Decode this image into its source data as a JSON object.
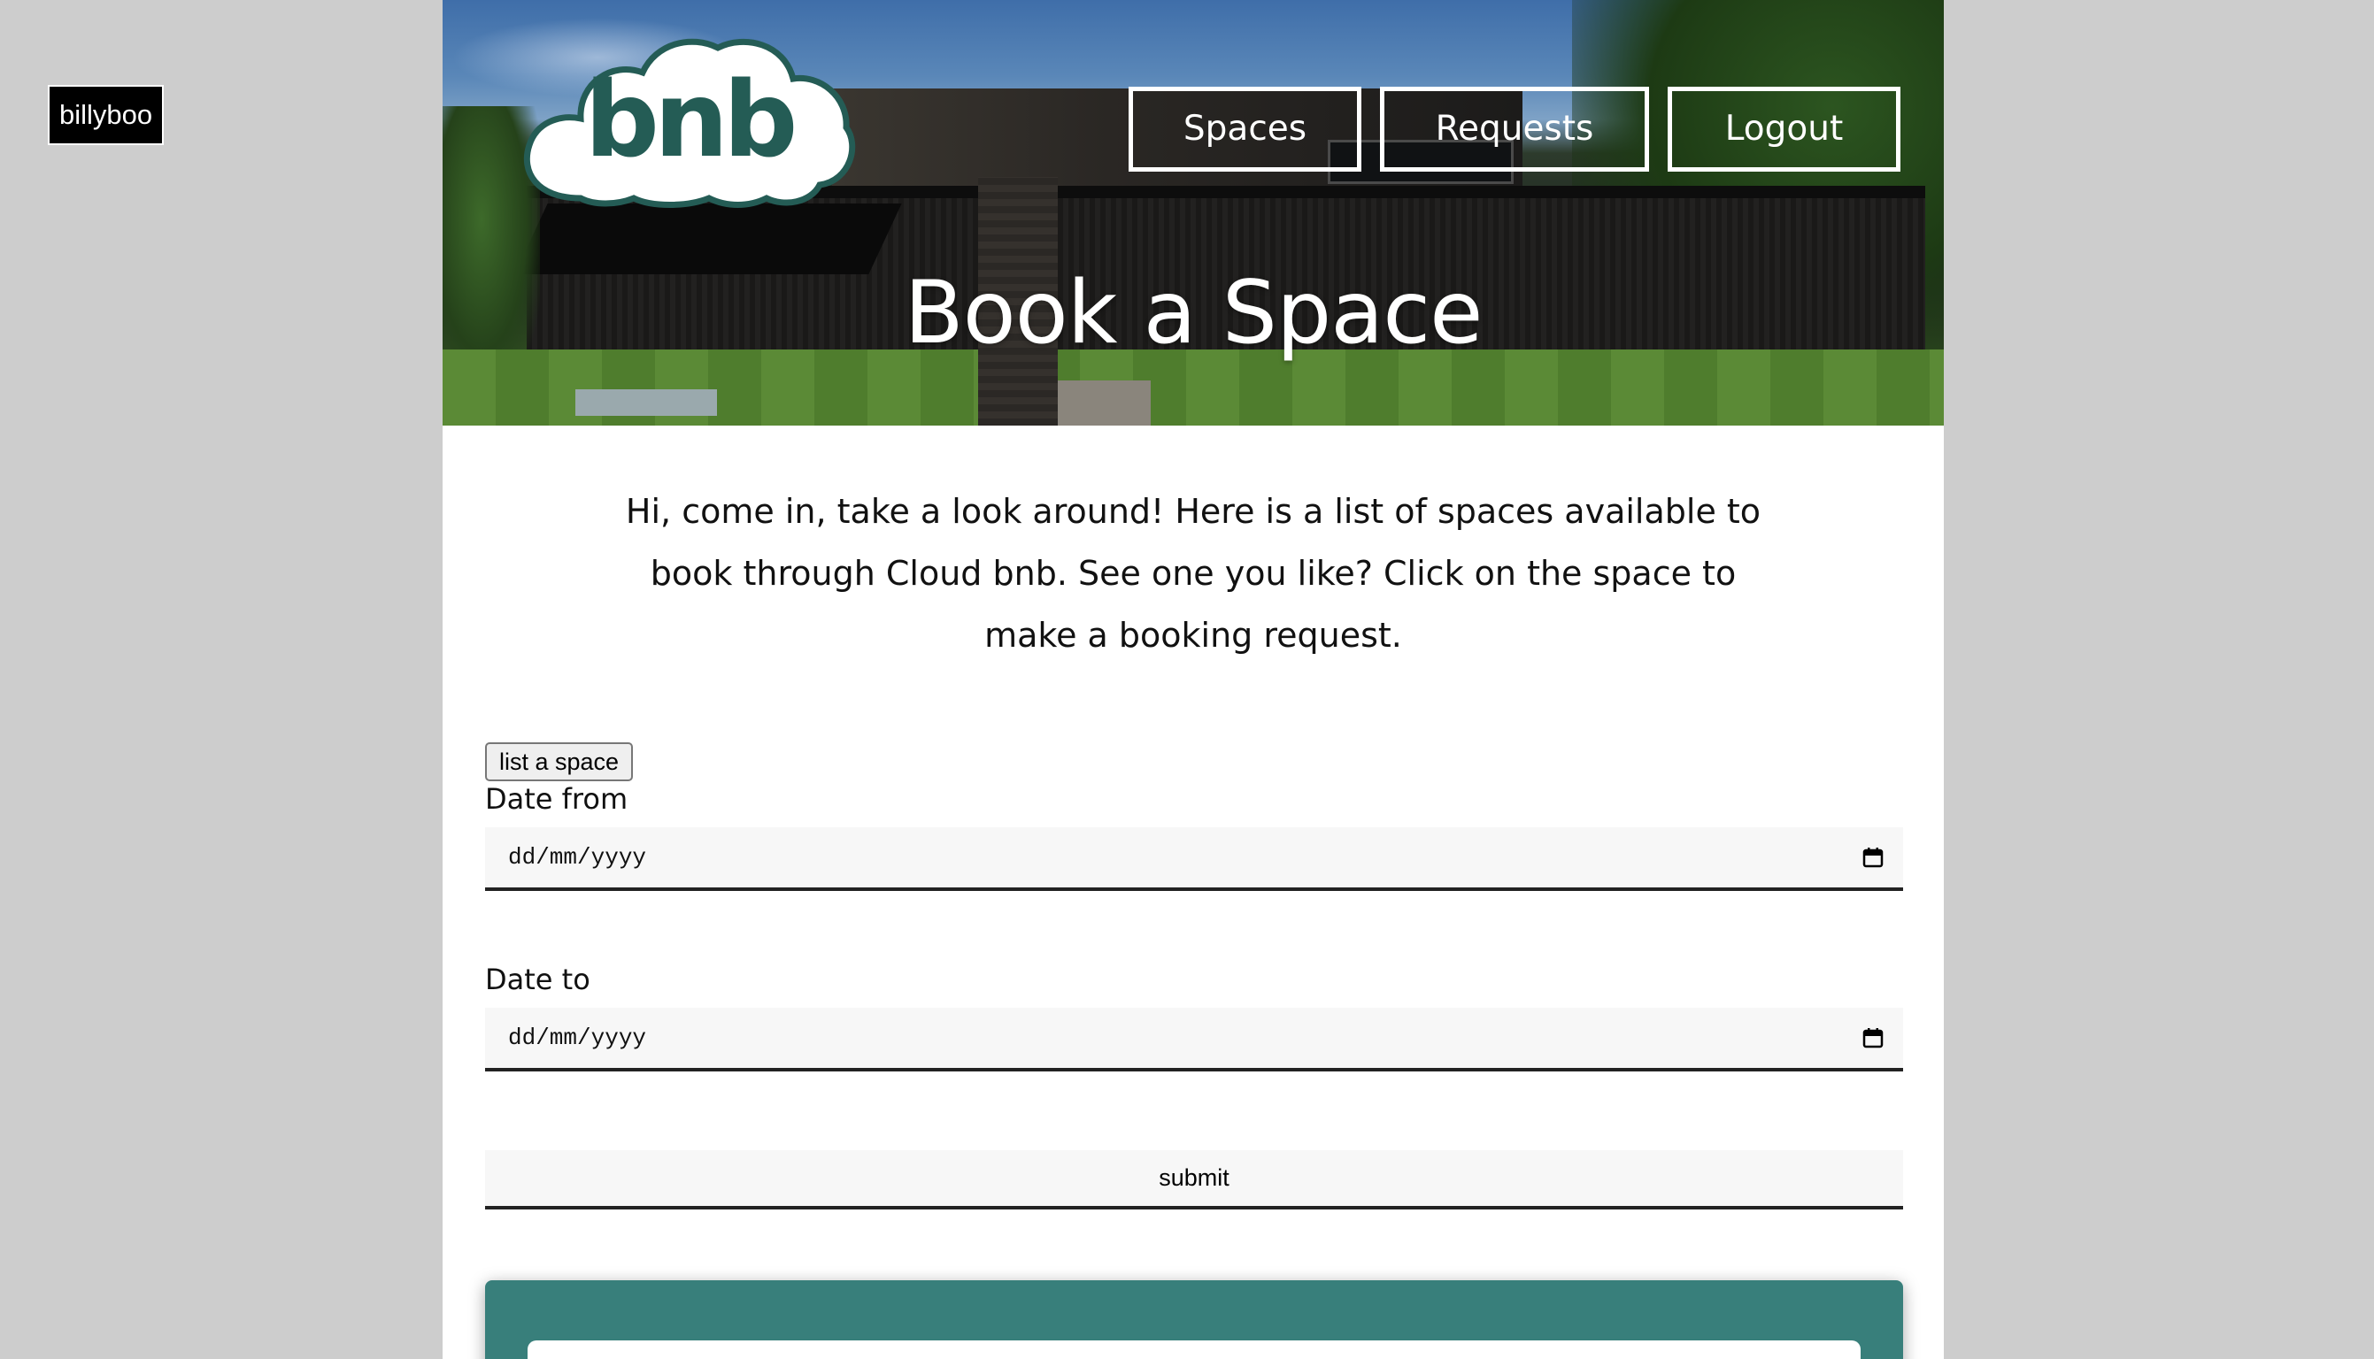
{
  "user": {
    "name": "billyboo"
  },
  "logo": {
    "text": "bnb"
  },
  "nav": {
    "items": [
      {
        "label": "Spaces"
      },
      {
        "label": "Requests"
      },
      {
        "label": "Logout"
      }
    ]
  },
  "hero": {
    "title": "Book a Space"
  },
  "intro": {
    "text": "Hi, come in, take a look around! Here is a list of spaces available to book through Cloud bnb. See one you like? Click on the space to make a booking request."
  },
  "actions": {
    "list_space_label": "list a space"
  },
  "form": {
    "date_from": {
      "label": "Date from",
      "placeholder": "dd/mm/yyyy"
    },
    "date_to": {
      "label": "Date to",
      "placeholder": "dd/mm/yyyy"
    },
    "submit_label": "submit"
  },
  "colors": {
    "brand_green": "#245c55",
    "panel_teal": "#387f7b",
    "page_bg": "#cdcdcd"
  }
}
